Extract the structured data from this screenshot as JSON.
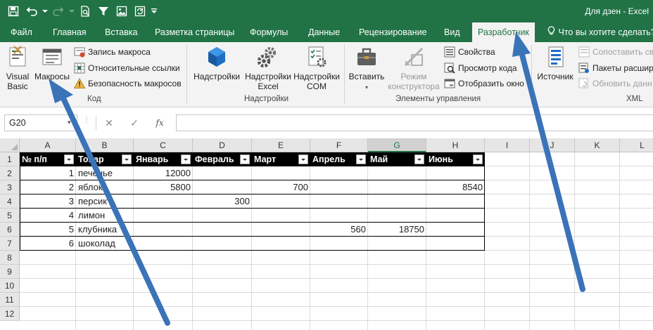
{
  "window": {
    "title": "Для дзен - Excel"
  },
  "tabs": [
    {
      "label": "Файл"
    },
    {
      "label": "Главная"
    },
    {
      "label": "Вставка"
    },
    {
      "label": "Разметка страницы"
    },
    {
      "label": "Формулы"
    },
    {
      "label": "Данные"
    },
    {
      "label": "Рецензирование"
    },
    {
      "label": "Вид"
    },
    {
      "label": "Разработчик"
    }
  ],
  "tell_me": "Что вы хотите сделать?",
  "ribbon": {
    "code": {
      "label": "Код",
      "visual_basic": "Visual Basic",
      "macros": "Макросы",
      "record_macro": "Запись макроса",
      "relative_refs": "Относительные ссылки",
      "macro_security": "Безопасность макросов"
    },
    "addins": {
      "label": "Надстройки",
      "addins": "Надстройки",
      "excel_addins": "Надстройки Excel",
      "com_addins": "Надстройки COM"
    },
    "controls": {
      "label": "Элементы управления",
      "insert": "Вставить",
      "design_mode": "Режим конструктора",
      "properties": "Свойства",
      "view_code": "Просмотр кода",
      "run_dialog": "Отобразить окно"
    },
    "xml": {
      "label": "XML",
      "source": "Источник",
      "map_properties": "Сопоставить сво",
      "expansion_packs": "Пакеты расшир",
      "refresh_data": "Обновить данн"
    }
  },
  "formula_bar": {
    "name_box": "G20",
    "formula": ""
  },
  "grid": {
    "columns": [
      "A",
      "B",
      "C",
      "D",
      "E",
      "F",
      "G",
      "H",
      "I",
      "J",
      "K",
      "L"
    ],
    "selected_column": "G",
    "rows": [
      "1",
      "2",
      "3",
      "4",
      "5",
      "6",
      "7",
      "8",
      "9",
      "10",
      "11",
      "12"
    ],
    "table_headers": [
      "№ п/п",
      "Товар",
      "Январь",
      "Февраль",
      "Март",
      "Апрель",
      "Май",
      "Июнь"
    ],
    "data": [
      [
        "1",
        "печенье",
        "12000",
        "",
        "",
        "",
        "",
        ""
      ],
      [
        "2",
        "яблоко",
        "5800",
        "",
        "700",
        "",
        "",
        "8540"
      ],
      [
        "3",
        "персик",
        "",
        "300",
        "",
        "",
        "",
        ""
      ],
      [
        "4",
        "лимон",
        "",
        "",
        "",
        "",
        "",
        ""
      ],
      [
        "5",
        "клубника",
        "",
        "",
        "",
        "560",
        "18750",
        ""
      ],
      [
        "6",
        "шоколад",
        "",
        "",
        "",
        "",
        "",
        ""
      ]
    ]
  },
  "colors": {
    "accent": "#217346",
    "arrow": "#3a73b8"
  }
}
